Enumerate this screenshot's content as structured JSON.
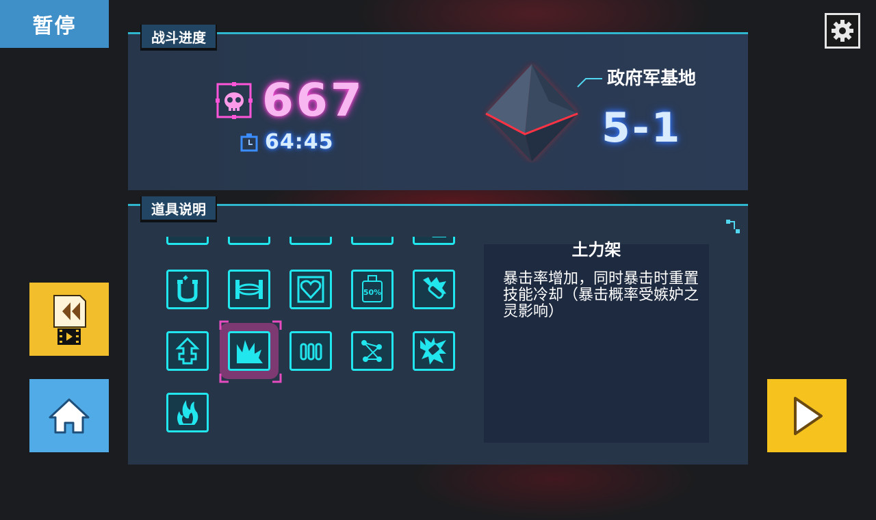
{
  "pause_label": "暂停",
  "battle_panel": {
    "tab_label": "战斗进度",
    "score": "667",
    "time": "64:45",
    "stage_name": "政府军基地",
    "stage_number": "5-1"
  },
  "items_panel": {
    "tab_label": "道具说明",
    "selected_item": {
      "name": "土力架",
      "description": "暴击率增加，同时暴击时重置技能冷却（暴击概率受嫉妒之灵影响）"
    },
    "grid": [
      {
        "icon": "item-partial-1-icon"
      },
      {
        "icon": "item-partial-2-icon"
      },
      {
        "icon": "item-partial-3-icon"
      },
      {
        "icon": "item-partial-4-icon"
      },
      {
        "icon": "item-partial-5-icon"
      },
      {
        "icon": "magnet-icon"
      },
      {
        "icon": "barbell-icon"
      },
      {
        "icon": "heart-icon"
      },
      {
        "icon": "bottle-50-icon",
        "label": "50%"
      },
      {
        "icon": "bandage-blast-icon"
      },
      {
        "icon": "arrow-up-icon"
      },
      {
        "icon": "explosion-icon"
      },
      {
        "icon": "bullets-icon"
      },
      {
        "icon": "network-icon"
      },
      {
        "icon": "ice-crystal-icon"
      },
      {
        "icon": "flame-hand-icon"
      }
    ]
  },
  "colors": {
    "accent_cyan": "#22e6ee",
    "score_pink": "#f9b7f2",
    "panel_bg": "#263548",
    "button_yellow": "#f3be2c",
    "button_blue": "#51abe6"
  }
}
